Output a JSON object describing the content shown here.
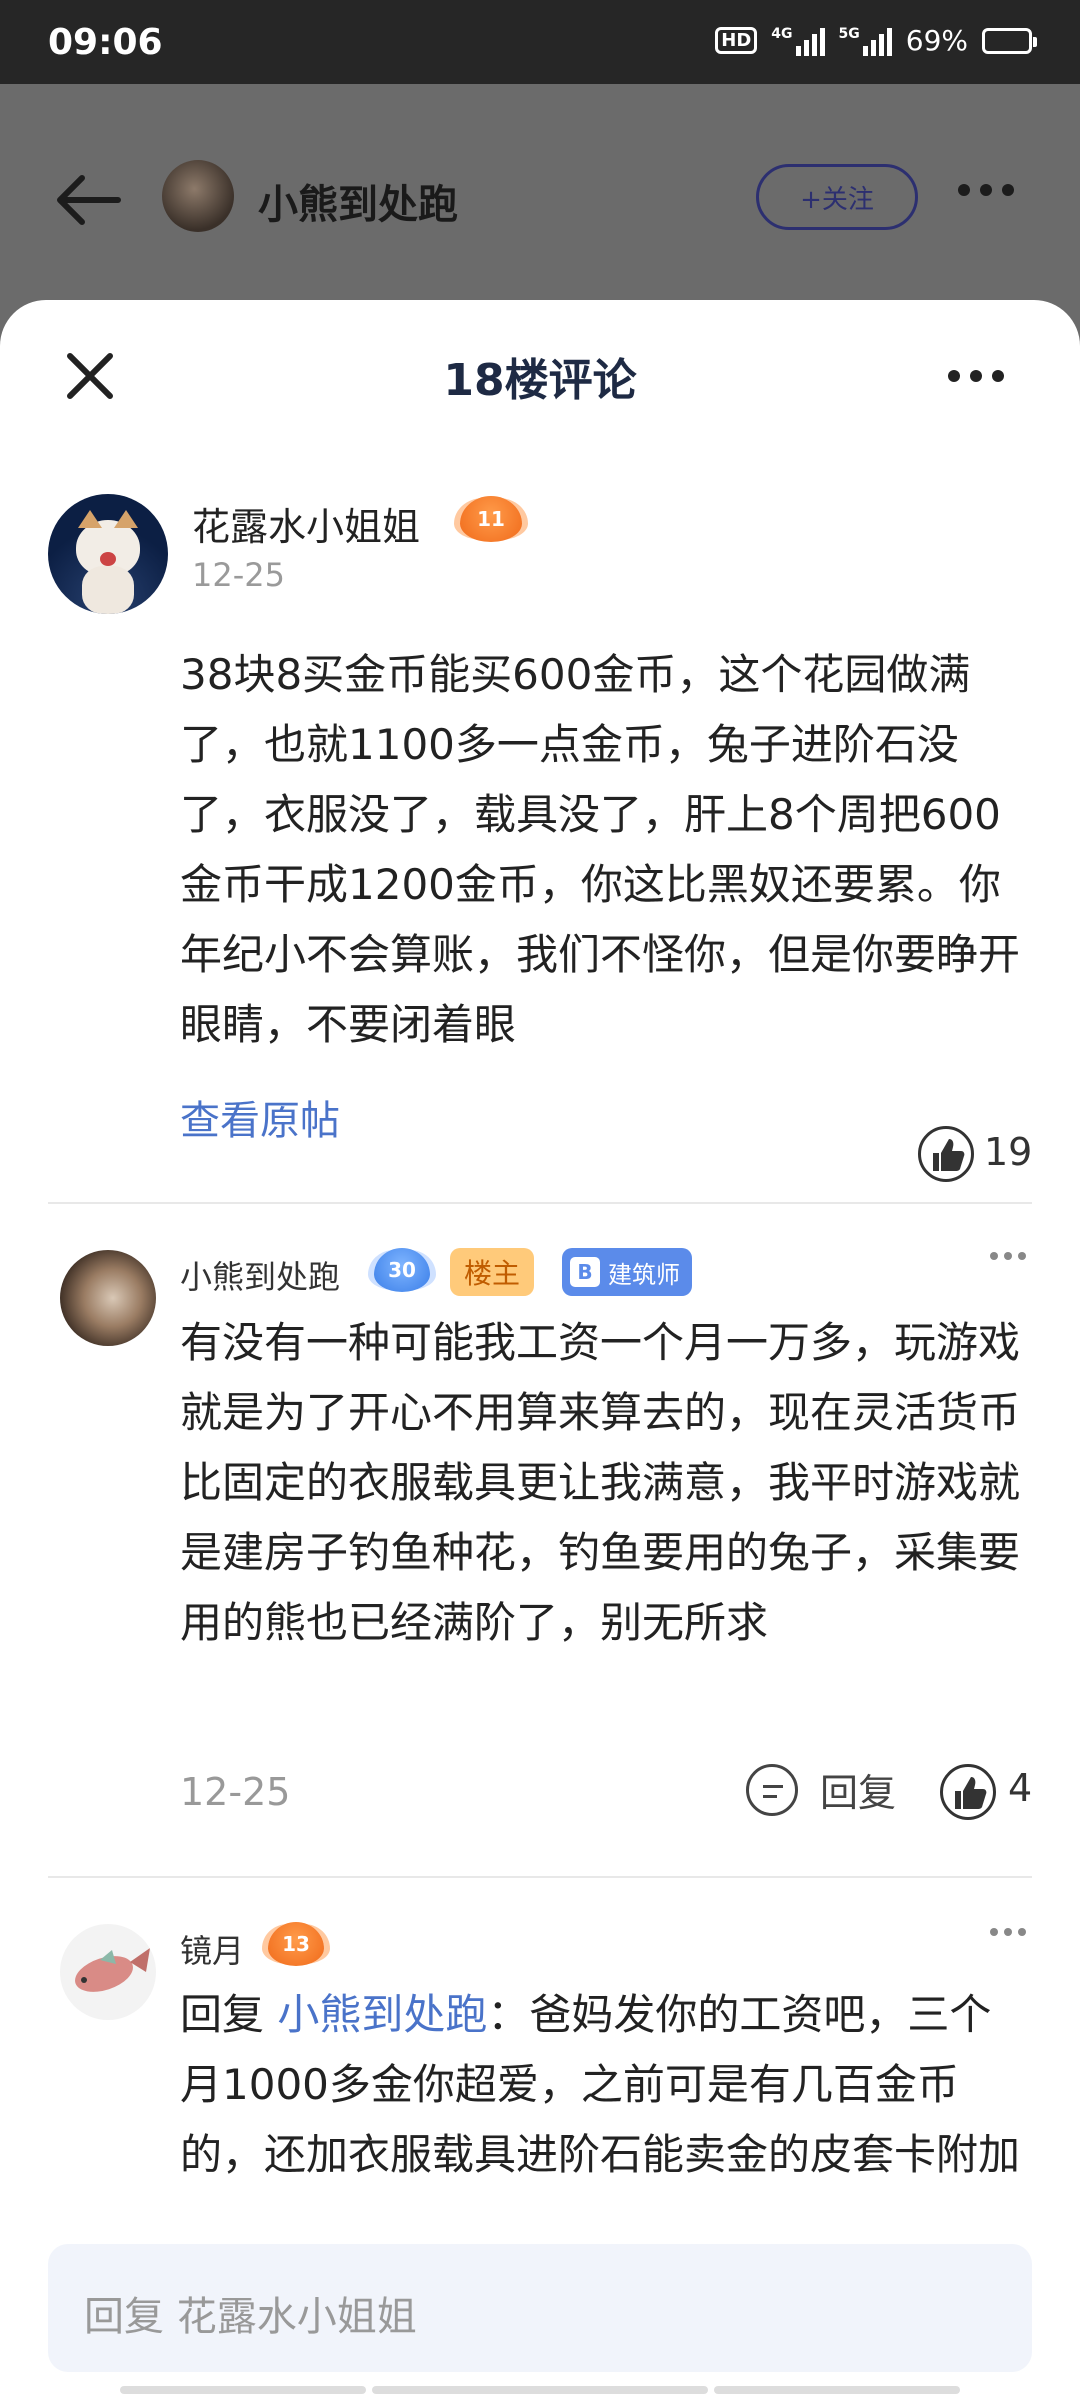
{
  "status_bar": {
    "time": "09:06",
    "hd": "HD",
    "net1": "4G",
    "net2": "5G",
    "battery": "69%"
  },
  "header": {
    "username": "小熊到处跑",
    "follow_label": "+关注"
  },
  "sheet": {
    "title": "18楼评论"
  },
  "main_comment": {
    "username": "花露水小姐姐",
    "level": "11",
    "date": "12-25",
    "text": "38块8买金币能买600金币，这个花园做满了，也就1100多一点金币，兔子进阶石没了，衣服没了，载具没了，肝上8个周把600金币干成1200金币，你这比黑奴还要累。你年纪小不会算账，我们不怪你，但是你要睁开眼睛，不要闭着眼",
    "view_original": "查看原帖",
    "likes": "19"
  },
  "replies": [
    {
      "username": "小熊到处跑",
      "level": "30",
      "tag_owner": "楼主",
      "tag_builder": "建筑师",
      "text": "有没有一种可能我工资一个月一万多，玩游戏就是为了开心不用算来算去的，现在灵活货币比固定的衣服载具更让我满意，我平时游戏就是建房子钓鱼种花，钓鱼要用的兔子，采集要用的熊也已经满阶了，别无所求",
      "date": "12-25",
      "reply_label": "回复",
      "likes": "4"
    },
    {
      "username": "镜月",
      "level": "13",
      "reply_prefix": "回复 ",
      "mention": "小熊到处跑",
      "text": "：爸妈发你的工资吧，三个月1000多金你超爱，之前可是有几百金币的，还加衣服载具进阶石能卖金的皮套卡附加头像框"
    }
  ],
  "input": {
    "placeholder": "回复 花露水小姐姐"
  }
}
